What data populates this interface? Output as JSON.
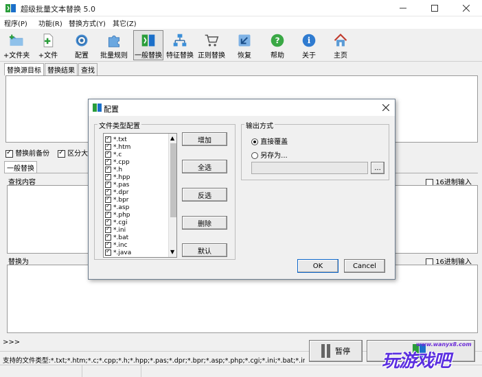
{
  "window": {
    "title": "超级批量文本替换 5.0"
  },
  "menu": [
    "程序(P)",
    "功能(R)",
    "替换方式(Y)",
    "其它(Z)"
  ],
  "toolbar": [
    {
      "label": "+文件夹",
      "icon": "folder-add-icon"
    },
    {
      "label": "+文件",
      "icon": "file-add-icon"
    },
    {
      "label": "配置",
      "icon": "config-gear-icon"
    },
    {
      "label": "批量规则",
      "icon": "puzzle-icon"
    },
    {
      "label": "一般替换",
      "icon": "replace-icon"
    },
    {
      "label": "特征替换",
      "icon": "network-icon"
    },
    {
      "label": "正则替换",
      "icon": "cart-icon"
    },
    {
      "label": "恢复",
      "icon": "restore-arrow-icon"
    },
    {
      "label": "帮助",
      "icon": "help-icon"
    },
    {
      "label": "关于",
      "icon": "info-icon"
    },
    {
      "label": "主页",
      "icon": "home-icon"
    }
  ],
  "main_tabs": [
    "替换源目标",
    "替换结果",
    "查找"
  ],
  "options": {
    "backup": "替换前备份",
    "case": "区分大小写"
  },
  "replace_tab": "一般替换",
  "find_label": "查找内容",
  "replace_label": "替换为",
  "hex_label": "16进制输入",
  "prompt": ">>>",
  "pause_label": "暂停",
  "status_text": "支持的文件类型:*.txt;*.htm;*.c;*.cpp;*.h;*.hpp;*.pas;*.dpr;*.bpr;*.asp;*.php;*.cgi;*.ini;*.bat;*.inc;*.java;*.py;*.dfm",
  "watermark": {
    "text": "玩游戏吧",
    "url": "www.wanyx8.com"
  },
  "dialog": {
    "title": "配置",
    "filetype_group": "文件类型配置",
    "filetypes": [
      "*.txt",
      "*.htm",
      "*.c",
      "*.cpp",
      "*.h",
      "*.hpp",
      "*.pas",
      "*.dpr",
      "*.bpr",
      "*.asp",
      "*.php",
      "*.cgi",
      "*.ini",
      "*.bat",
      "*.inc",
      "*.java"
    ],
    "buttons": {
      "add": "增加",
      "select_all": "全选",
      "invert": "反选",
      "delete": "删除",
      "default": "默认"
    },
    "output_group": "输出方式",
    "output_options": [
      "直接覆盖",
      "另存为..."
    ],
    "browse": "...",
    "ok": "OK",
    "cancel": "Cancel"
  },
  "colors": {
    "accent": "#0a64c8",
    "select": "#3399ff"
  }
}
